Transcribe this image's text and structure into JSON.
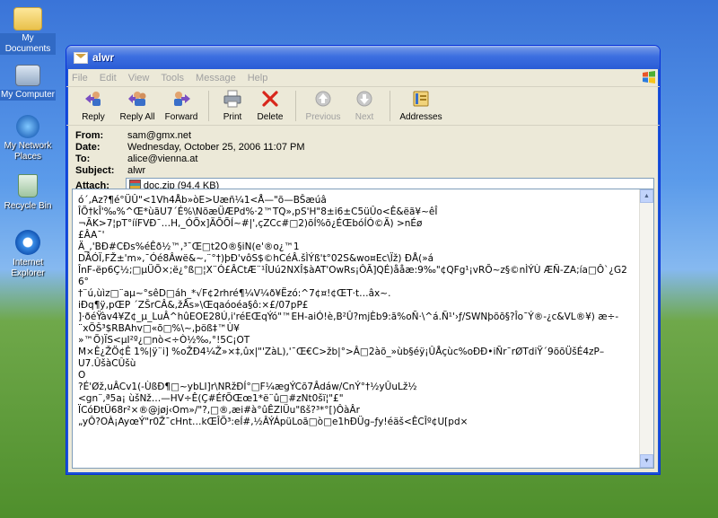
{
  "desktop": {
    "icons": [
      {
        "label": "My Documents"
      },
      {
        "label": "My Computer"
      },
      {
        "label": "My Network Places"
      },
      {
        "label": "Recycle Bin"
      },
      {
        "label": "Internet Explorer"
      }
    ]
  },
  "window": {
    "title": "alwr"
  },
  "menu": {
    "file": "File",
    "edit": "Edit",
    "view": "View",
    "tools": "Tools",
    "message": "Message",
    "help": "Help"
  },
  "toolbar": {
    "reply": "Reply",
    "reply_all": "Reply All",
    "forward": "Forward",
    "print": "Print",
    "delete": "Delete",
    "previous": "Previous",
    "next": "Next",
    "addresses": "Addresses"
  },
  "headers": {
    "from_label": "From:",
    "from": "sam@gmx.net",
    "date_label": "Date:",
    "date": "Wednesday, October 25, 2006 11:07 PM",
    "to_label": "To:",
    "to": "alice@vienna.at",
    "subject_label": "Subject:",
    "subject": "alwr",
    "attach_label": "Attach:",
    "attachment": "doc.zip (94.4 KB)"
  },
  "body": {
    "text": "ó´,Az?¶é°ÜÛ\"<1Vh4Åb»òE>Uæñ¼1<Å—\"õ—BŠæúâ\nÎÕ†kÎ'‰%^Œ*ùãU7´É%\\NõæÜÆPd%·2™TQ»,pS'H\"8±i6±C5üÛo<Ê&ëã¥~êÎ\n¬ÃK>7¦pT°ííFVĐ¯…H,_ÓÕx]ÄÕÕÍ~#|',çZCc#□2)õÍ%õ¿ÉŒbóÍÓ©Ä) >nÉø\n£ÂA¯'\nÄ_,'BÐ#CÐs%éÊð½™,³¯Œ□t2O®§iN(e'®o¿™1\nDÂÓÏ,FŽ±'m»,¯Óé8Âwë&~,¨°†)þÐ'vôS$©hCéÂ.šÌÝß't°02S&wo¤Ec\\Ïž) ÐÅ(»á\nÎnF-ëp6Ç½;□µÜÕ×;ë¿°ß□¦X¨Ó£ÂCtÆ¨¹ÎUú2NXÎ$àAT'OwRs¡ÔÃ]QÉ)ååæ:9‰\"¢QFg¹¡vRÕ~z§©nÌÝÙ ÆÑ-ZA;ía□Ô`¿G26°\n†¨ú,ùìz□¨aµ~°sêD□áh_*√F¢2rhré¶¼V¼ð¥Ëzó:^7¢¤!¢ŒT·t…âx~.\niÐq¶ÿ,pŒP ´ZŠrCÂ&,žÅs»\\Œqaóoéa§ô:×£/07pP£\n]·ðéŸàv4¥Z¢_µ_LuÂ^hûEOE28Ú,i'réEŒqÝó\"™EH-aiÓ!è,B²Û?mjÈb9:ã%oÑ·\\^á.Ñ¹'›ƒ/SWNþõõ§?Îo¯Ý®-¿c&VL®¥) æ÷-\n¨xÖŠ³$RBAhv□«õ□%\\~,þöß‡™Ù¥\n»™Õ)ÏS<µI²º¿□nò<÷Ò½‰,°!5C¡OT\nM×Ê¿ŽÖ¢Ê 1%|ÿ¨i] %oŽÐ4¼Ž»×‡,ûx|\"'ZàL),'¯Œ€C>žb|°>Â□2àõ_»ùb§éÿ¡ÛÅçùc%oÐÐ•iÑr¯rØTdiŸ´9õõÜšÉ4zP–\nU7.ÛšàCÛšù\nO\n?É'Øž,uÂCv1(-ÙßÐ¶□~ybLI]r\\NRžÐÍ°□F¼ægÝCõ7Âdáw/CnÝ°†½yÛuLž½\n<gn¨,ª5a¡ ùšNž…—HV÷Ê(Ç#ÉfÕŒœ1*ë¨û□#zNt0šï¦\"£\"\nÏCóÐtÜ68r²×®@jøj‹Om»/\"?,□®,æi#à°ûÊZlÜu\"ßš?³*°[)ÔàÂr\n„yÔ?OÀ¡AyœÝ\"r0Ž¯cHnt…kŒÎÕ³:eÍ#,½ÂÝÁpüLoã□ò□e1hÐÜg–ƒy!éäš<ÊCÎº¢U[pd×"
  }
}
